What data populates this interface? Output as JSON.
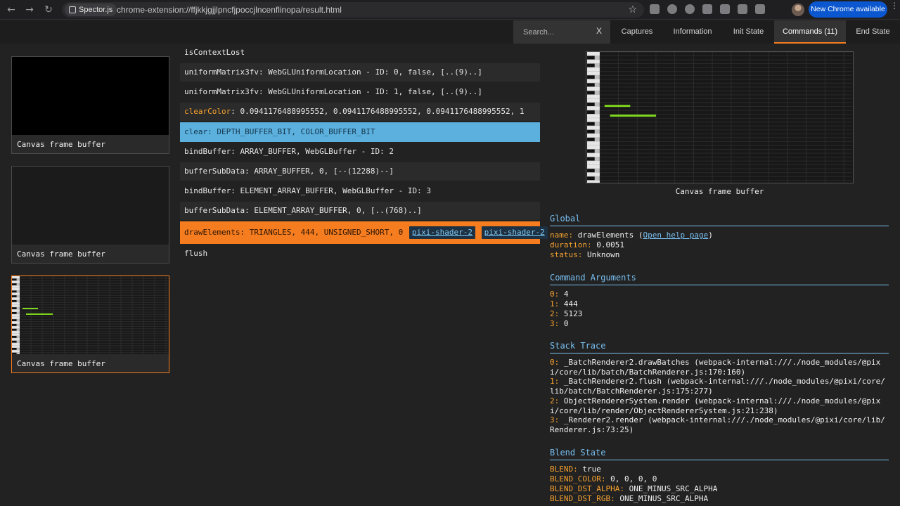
{
  "browser": {
    "site_chip": "Spector.js",
    "url": "chrome-extension://ffjkkjgjjlpncfjpoccjlncenflinopa/result.html",
    "update_button": "New Chrome available"
  },
  "header": {
    "search_placeholder": "Search...",
    "search_clear": "X",
    "tabs": [
      "Captures",
      "Information",
      "Init State",
      "Commands (11)",
      "End State"
    ],
    "active_tab": "Commands (11)"
  },
  "thumbnails": [
    {
      "label": "Canvas frame buffer"
    },
    {
      "label": "Canvas frame buffer"
    },
    {
      "label": "Canvas frame buffer"
    }
  ],
  "commands": [
    {
      "name": "isContextLost",
      "args": ""
    },
    {
      "name": "uniformMatrix3fv",
      "args": ": WebGLUniformLocation - ID: 0, false, [..(9)..]"
    },
    {
      "name": "uniformMatrix3fv",
      "args": ": WebGLUniformLocation - ID: 1, false, [..(9)..]"
    },
    {
      "name": "clearColor",
      "args": ": 0.0941176488995552, 0.0941176488995552, 0.0941176488995552, 1"
    },
    {
      "name": "clear",
      "args": ": DEPTH_BUFFER_BIT, COLOR_BUFFER_BIT"
    },
    {
      "name": "bindBuffer",
      "args": ": ARRAY_BUFFER, WebGLBuffer - ID: 2"
    },
    {
      "name": "bufferSubData",
      "args": ": ARRAY_BUFFER, 0, [--(12288)--]"
    },
    {
      "name": "bindBuffer",
      "args": ": ELEMENT_ARRAY_BUFFER, WebGLBuffer - ID: 3"
    },
    {
      "name": "bufferSubData",
      "args": ": ELEMENT_ARRAY_BUFFER, 0, [..(768)..]"
    },
    {
      "name": "drawElements",
      "args": ": TRIANGLES, 444, UNSIGNED_SHORT, 0",
      "links": [
        "pixi-shader-2",
        "pixi-shader-2"
      ]
    },
    {
      "name": "flush",
      "args": ""
    }
  ],
  "preview": {
    "label": "Canvas frame buffer"
  },
  "global": {
    "title": "Global",
    "name_key": "name:",
    "name_val": "drawElements",
    "help_link": "Open help page",
    "duration_key": "duration:",
    "duration_val": "0.0051",
    "status_key": "status:",
    "status_val": "Unknown"
  },
  "arguments": {
    "title": "Command Arguments",
    "items": [
      {
        "k": "0:",
        "v": "4"
      },
      {
        "k": "1:",
        "v": "444"
      },
      {
        "k": "2:",
        "v": "5123"
      },
      {
        "k": "3:",
        "v": "0"
      }
    ]
  },
  "stack": {
    "title": "Stack Trace",
    "items": [
      {
        "k": "0:",
        "v": "_BatchRenderer2.drawBatches (webpack-internal:///./node_modules/@pixi/core/lib/batch/BatchRenderer.js:170:160)"
      },
      {
        "k": "1:",
        "v": "_BatchRenderer2.flush (webpack-internal:///./node_modules/@pixi/core/lib/batch/BatchRenderer.js:175:277)"
      },
      {
        "k": "2:",
        "v": "ObjectRendererSystem.render (webpack-internal:///./node_modules/@pixi/core/lib/render/ObjectRendererSystem.js:21:238)"
      },
      {
        "k": "3:",
        "v": "_Renderer2.render (webpack-internal:///./node_modules/@pixi/core/lib/Renderer.js:73:25)"
      }
    ]
  },
  "blend": {
    "title": "Blend State",
    "items": [
      {
        "k": "BLEND:",
        "v": "true"
      },
      {
        "k": "BLEND_COLOR:",
        "v": "0, 0, 0, 0"
      },
      {
        "k": "BLEND_DST_ALPHA:",
        "v": "ONE_MINUS_SRC_ALPHA"
      },
      {
        "k": "BLEND_DST_RGB:",
        "v": "ONE_MINUS_SRC_ALPHA"
      }
    ]
  },
  "colors": {
    "accent_orange": "#f57c1f",
    "selected_blue": "#5bb0de",
    "section_blue": "#78bff0",
    "key_orange": "#f5a12f",
    "note_green": "#7fd61d"
  }
}
